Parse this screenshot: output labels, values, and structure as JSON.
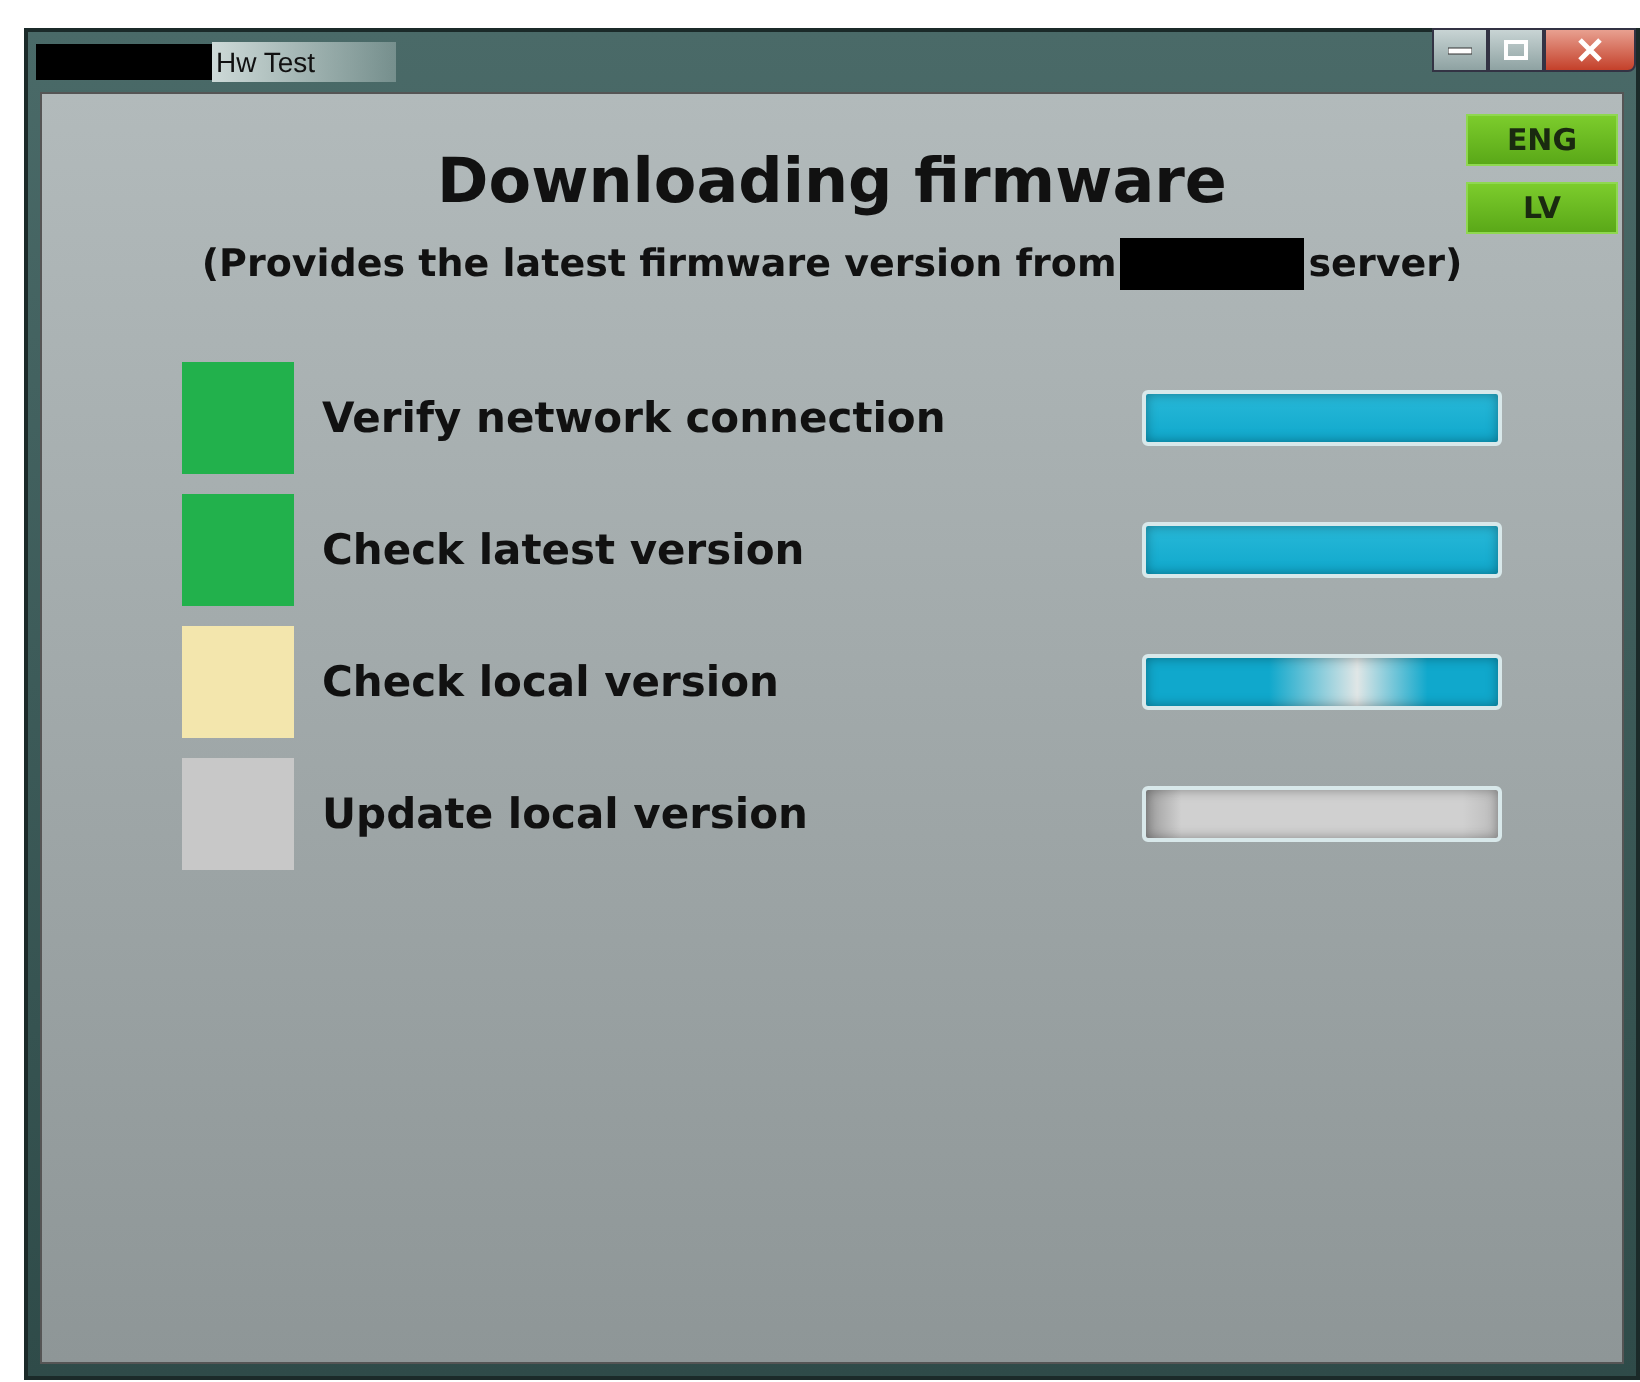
{
  "window": {
    "title": "Hw Test"
  },
  "languages": [
    {
      "label": "ENG"
    },
    {
      "label": "LV"
    }
  ],
  "heading": "Downloading firmware",
  "subtitle": {
    "before": "(Provides the latest firmware version from",
    "after": "server)"
  },
  "steps": [
    {
      "label": "Verify network connection",
      "color": "#22b14c",
      "kind": "full"
    },
    {
      "label": "Check latest version",
      "color": "#22b14c",
      "kind": "full"
    },
    {
      "label": "Check local version",
      "color": "#f3e6ad",
      "kind": "marquee"
    },
    {
      "label": "Update local version",
      "color": "#c8c8c8",
      "kind": "empty"
    }
  ]
}
